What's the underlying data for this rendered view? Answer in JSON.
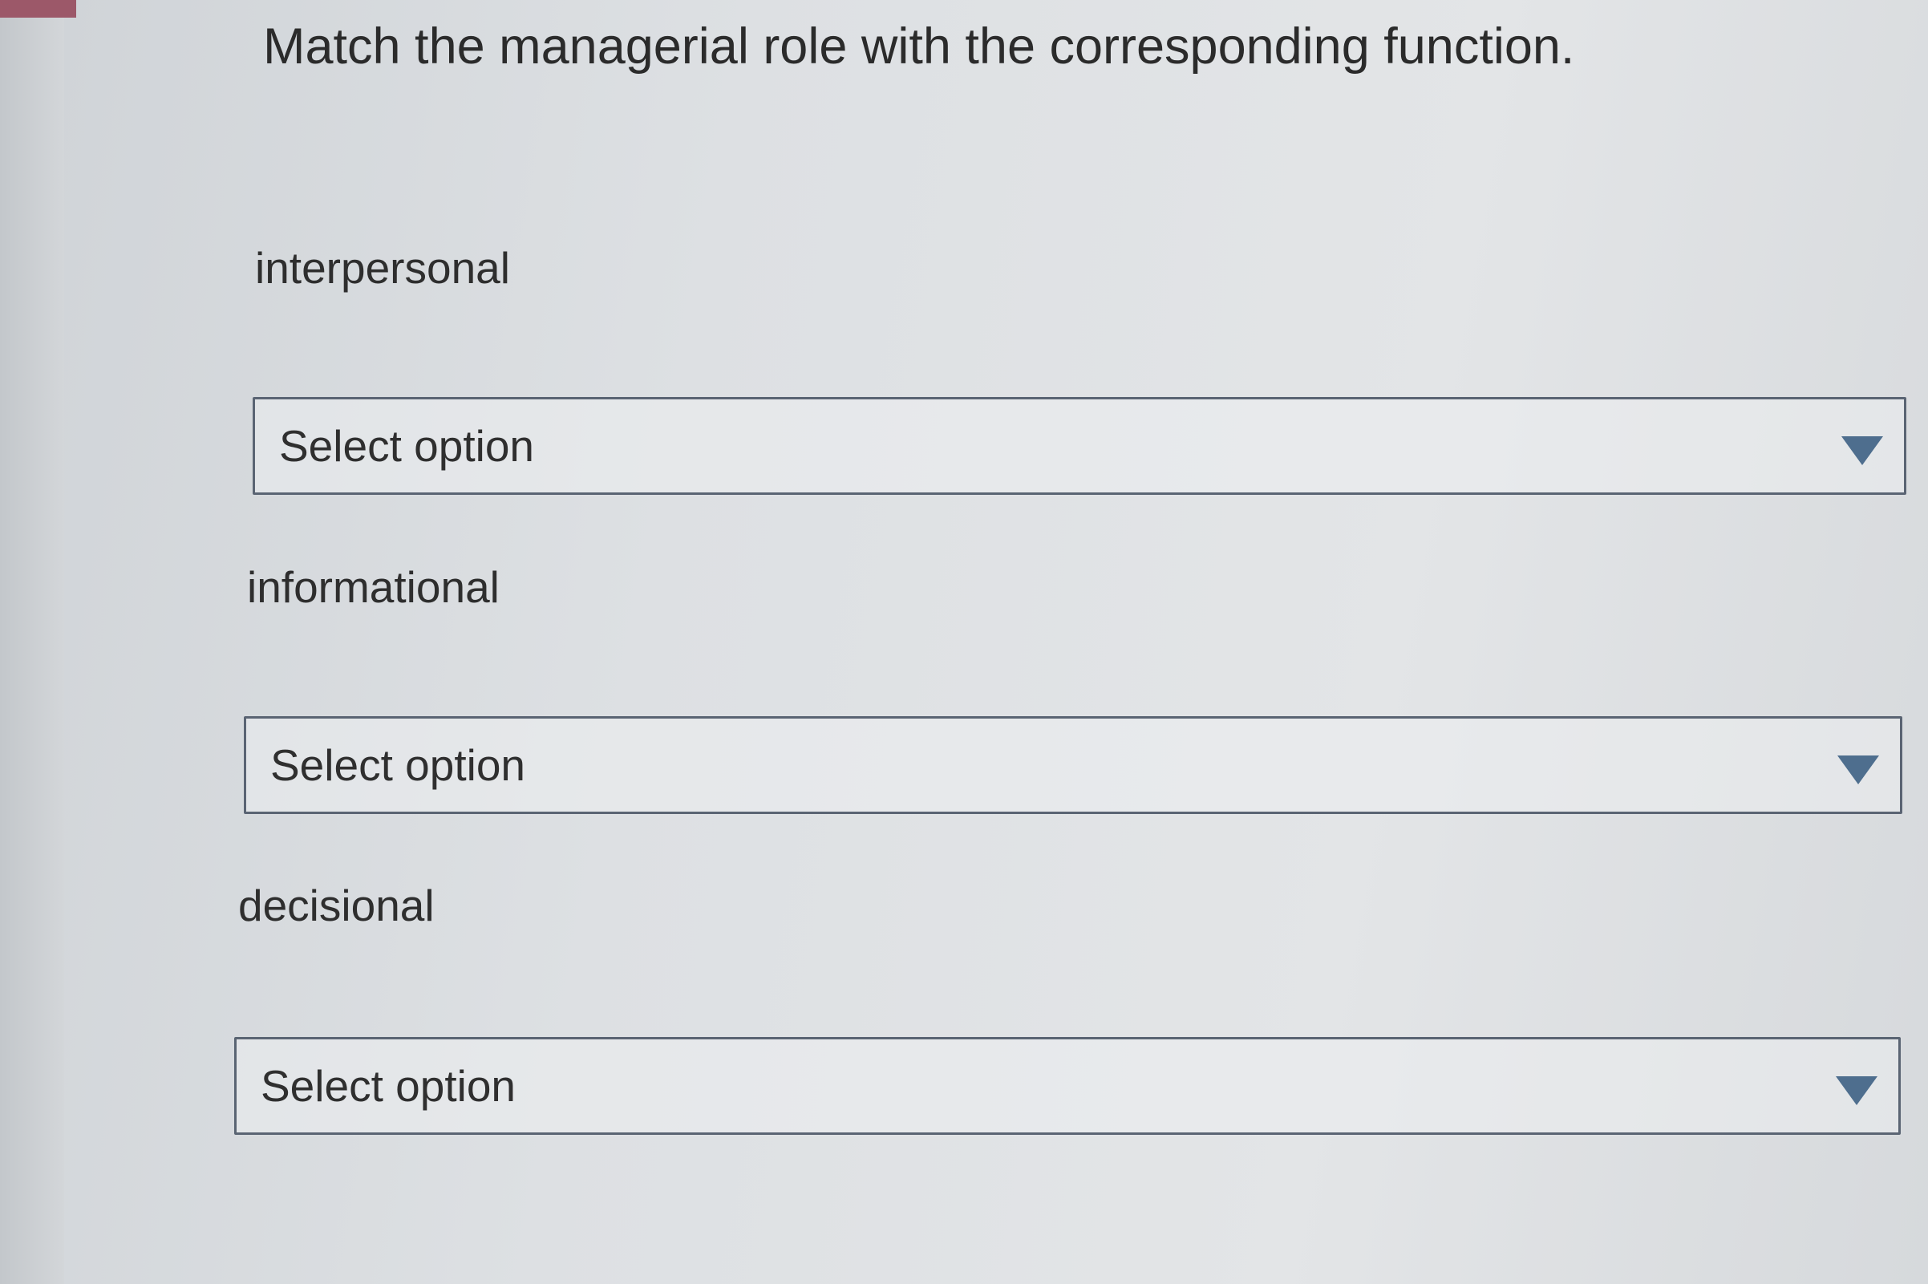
{
  "question": {
    "prompt": "Match the managerial role with the corresponding function."
  },
  "rows": [
    {
      "label": "interpersonal",
      "select": {
        "value": "Select option",
        "icon": "caret-down-icon"
      }
    },
    {
      "label": "informational",
      "select": {
        "value": "Select option",
        "icon": "caret-down-icon"
      }
    },
    {
      "label": "decisional",
      "select": {
        "value": "Select option",
        "icon": "caret-down-icon"
      }
    }
  ],
  "colors": {
    "caret": "#4e6e8e",
    "border": "#5a6473",
    "text": "#2e2e2e",
    "accent": "#9c5869"
  }
}
